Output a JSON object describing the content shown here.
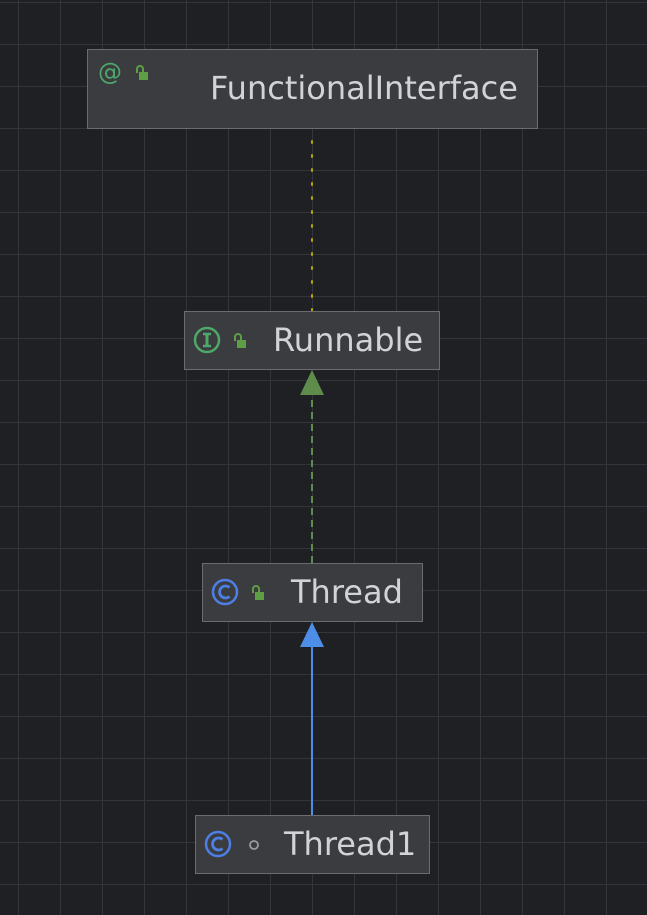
{
  "diagram": {
    "nodes": [
      {
        "id": "functional-interface",
        "name": "FunctionalInterface",
        "kind": "annotation",
        "kind_icon": "annotation-icon",
        "visibility": "public",
        "visibility_icon": "unlocked-icon"
      },
      {
        "id": "runnable",
        "name": "Runnable",
        "kind": "interface",
        "kind_icon": "interface-icon",
        "visibility": "public",
        "visibility_icon": "unlocked-icon"
      },
      {
        "id": "thread",
        "name": "Thread",
        "kind": "class",
        "kind_icon": "class-icon",
        "visibility": "public",
        "visibility_icon": "unlocked-icon"
      },
      {
        "id": "thread1",
        "name": "Thread1",
        "kind": "class",
        "kind_icon": "class-icon",
        "visibility": "package-private",
        "visibility_icon": "package-private-dot-icon"
      }
    ],
    "edges": [
      {
        "from": "runnable",
        "to": "functional-interface",
        "type": "annotated-by",
        "style": "dotted",
        "color": "#b5a600"
      },
      {
        "from": "thread",
        "to": "runnable",
        "type": "implements",
        "style": "dashed",
        "color": "#5f8c4a"
      },
      {
        "from": "thread1",
        "to": "thread",
        "type": "extends",
        "style": "solid",
        "color": "#4d8ee8"
      }
    ]
  },
  "colors": {
    "background": "#1f2023",
    "grid": "#33353a",
    "node_fill": "#3b3c3f",
    "node_border": "#6a6c70",
    "node_text": "#d2d3d6",
    "annotation_icon": "#4fa86a",
    "interface_icon": "#4fa86a",
    "class_icon": "#4d7fe6",
    "lock_icon": "#5e9e45"
  }
}
